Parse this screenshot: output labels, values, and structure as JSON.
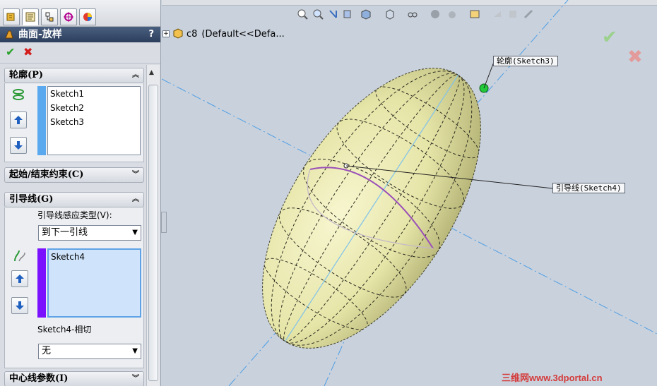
{
  "feature": {
    "title": "曲面-放样",
    "help": "?",
    "ok_glyph": "✔",
    "cancel_glyph": "✖"
  },
  "groups": {
    "profile": {
      "header": "轮廓(P)",
      "items": [
        "Sketch1",
        "Sketch2",
        "Sketch3"
      ]
    },
    "constraints": {
      "header": "起始/结束约束(C)"
    },
    "guides": {
      "header": "引导线(G)",
      "influence_label": "引导线感应类型(V):",
      "influence_value": "到下一引线",
      "items": [
        "Sketch4"
      ],
      "tangency_label": "Sketch4-相切",
      "tangency_value": "无"
    },
    "centerline": {
      "header": "中心线参数(I)"
    }
  },
  "tree": {
    "node": "c8",
    "config": "(Default<<Defa..."
  },
  "callouts": {
    "profile": "轮廓(Sketch3)",
    "guide": "引导线(Sketch4)"
  },
  "watermark": "三维网www.3dportal.cn",
  "colors": {
    "profile_bar": "#5aa9ef",
    "guide_bar": "#7a12ff",
    "surface": "#e6e5a8",
    "guide_curve": "#9a4fb8",
    "axis_line": "#4e9fe6"
  }
}
